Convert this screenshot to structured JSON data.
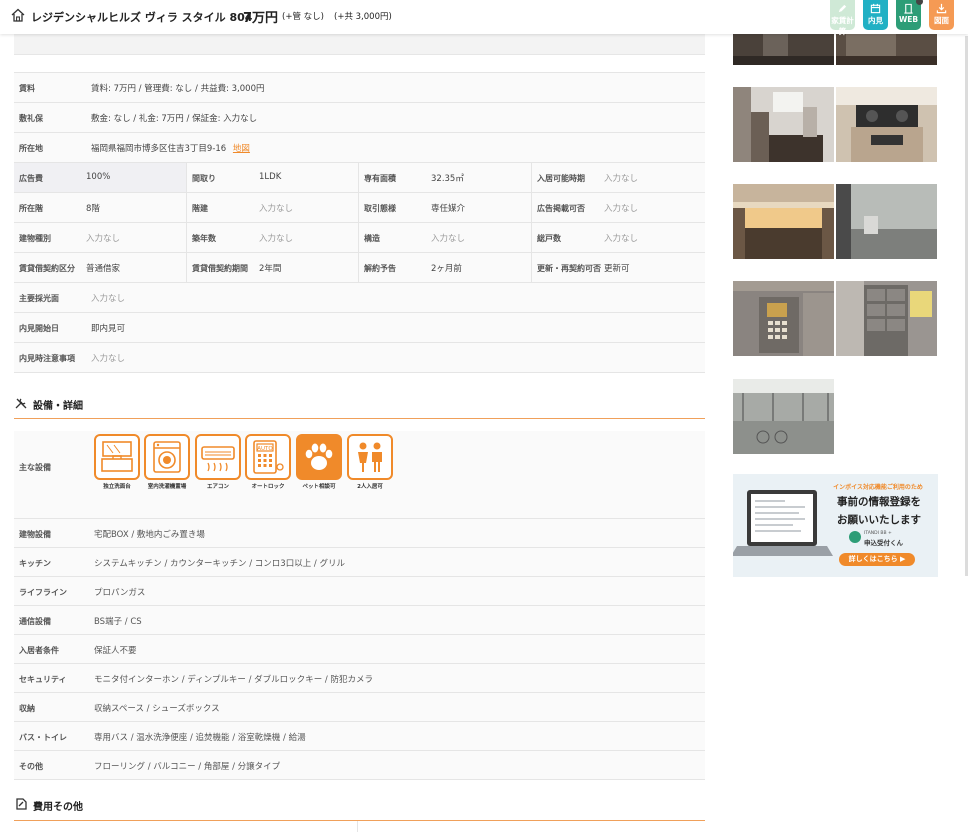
{
  "header": {
    "property_name": "レジデンシャルヒルズ ヴィラ スタイル 804",
    "price": "7万円",
    "management_fee": "(+管 なし)",
    "common_fee": "(+共 3,000円)",
    "buttons": [
      {
        "label": "家賃計算",
        "color": "#7cc690"
      },
      {
        "label": "内見",
        "color": "#21b0c4"
      },
      {
        "label": "WEB",
        "color": "#2d9d77"
      },
      {
        "label": "図面",
        "color": "#f59a54"
      }
    ]
  },
  "info": {
    "rent": {
      "label": "賃料",
      "value": "賃料: 7万円 / 管理費: なし / 共益費: 3,000円"
    },
    "deposit": {
      "label": "敷礼保",
      "value": "敷金: なし / 礼金: 7万円 / 保証金: 入力なし"
    },
    "address": {
      "label": "所在地",
      "value": "福岡県福岡市博多区住吉3丁目9-16",
      "map_link": "地図"
    },
    "grid_rows": [
      [
        {
          "label": "広告費",
          "value": "100%"
        },
        {
          "label": "間取り",
          "value": "1LDK"
        },
        {
          "label": "専有面積",
          "value": "32.35㎡"
        },
        {
          "label": "入居可能時期",
          "value": "入力なし"
        }
      ],
      [
        {
          "label": "所在階",
          "value": "8階"
        },
        {
          "label": "階建",
          "value": "入力なし"
        },
        {
          "label": "取引態様",
          "value": "専任媒介"
        },
        {
          "label": "広告掲載可否",
          "value": "入力なし"
        }
      ],
      [
        {
          "label": "建物種別",
          "value": "入力なし"
        },
        {
          "label": "築年数",
          "value": "入力なし"
        },
        {
          "label": "構造",
          "value": "入力なし"
        },
        {
          "label": "総戸数",
          "value": "入力なし"
        }
      ],
      [
        {
          "label": "賃貸借契約区分",
          "value": "普通借家"
        },
        {
          "label": "賃貸借契約期間",
          "value": "2年間"
        },
        {
          "label": "解約予告",
          "value": "2ヶ月前"
        },
        {
          "label": "更新・再契約可否",
          "value": "更新可"
        }
      ]
    ],
    "lighting": {
      "label": "主要採光面",
      "value": "入力なし"
    },
    "viewing_start": {
      "label": "内見開始日",
      "value": "即内見可"
    },
    "viewing_notes": {
      "label": "内見時注意事項",
      "value": "入力なし"
    }
  },
  "equipment": {
    "title": "設備・詳細",
    "main_label": "主な設備",
    "icons": [
      {
        "name": "washstand-icon",
        "label": "独立洗面台"
      },
      {
        "name": "washer-icon",
        "label": "室内洗濯機置場"
      },
      {
        "name": "aircon-icon",
        "label": "エアコン"
      },
      {
        "name": "autolock-icon",
        "label": "オートロック"
      },
      {
        "name": "pet-icon",
        "label": "ペット相談可"
      },
      {
        "name": "two-people-icon",
        "label": "2人入居可"
      }
    ],
    "rows": [
      {
        "label": "建物設備",
        "value": "宅配BOX / 敷地内ごみ置き場"
      },
      {
        "label": "キッチン",
        "value": "システムキッチン / カウンターキッチン / コンロ3口以上 / グリル"
      },
      {
        "label": "ライフライン",
        "value": "プロパンガス"
      },
      {
        "label": "通信設備",
        "value": "BS端子 / CS"
      },
      {
        "label": "入居者条件",
        "value": "保証人不要"
      },
      {
        "label": "セキュリティ",
        "value": "モニタ付インターホン / ディンプルキー / ダブルロックキー / 防犯カメラ"
      },
      {
        "label": "収納",
        "value": "収納スペース / シューズボックス"
      },
      {
        "label": "バス・トイレ",
        "value": "専用バス / 温水洗浄便座 / 追焚機能 / 浴室乾燥機 / 給湯"
      },
      {
        "label": "その他",
        "value": "フローリング / バルコニー / 角部屋 / 分譲タイプ"
      }
    ]
  },
  "costs": {
    "title": "費用その他"
  },
  "sidebar": {
    "photos": [
      "hallway-photo",
      "room-photo",
      "living-room-photo",
      "stove-photo",
      "closet-light-photo",
      "balcony-photo",
      "intercom-photo",
      "mailbox-photo",
      "parking-photo"
    ],
    "ad": {
      "top_line": "インボイス対応機能ご利用のため",
      "headline_1": "事前の情報登録を",
      "headline_2": "お願いいたします",
      "brand_small": "ITANDI BB +",
      "brand": "申込受付くん",
      "button": "詳しくはこちら ▶"
    }
  }
}
